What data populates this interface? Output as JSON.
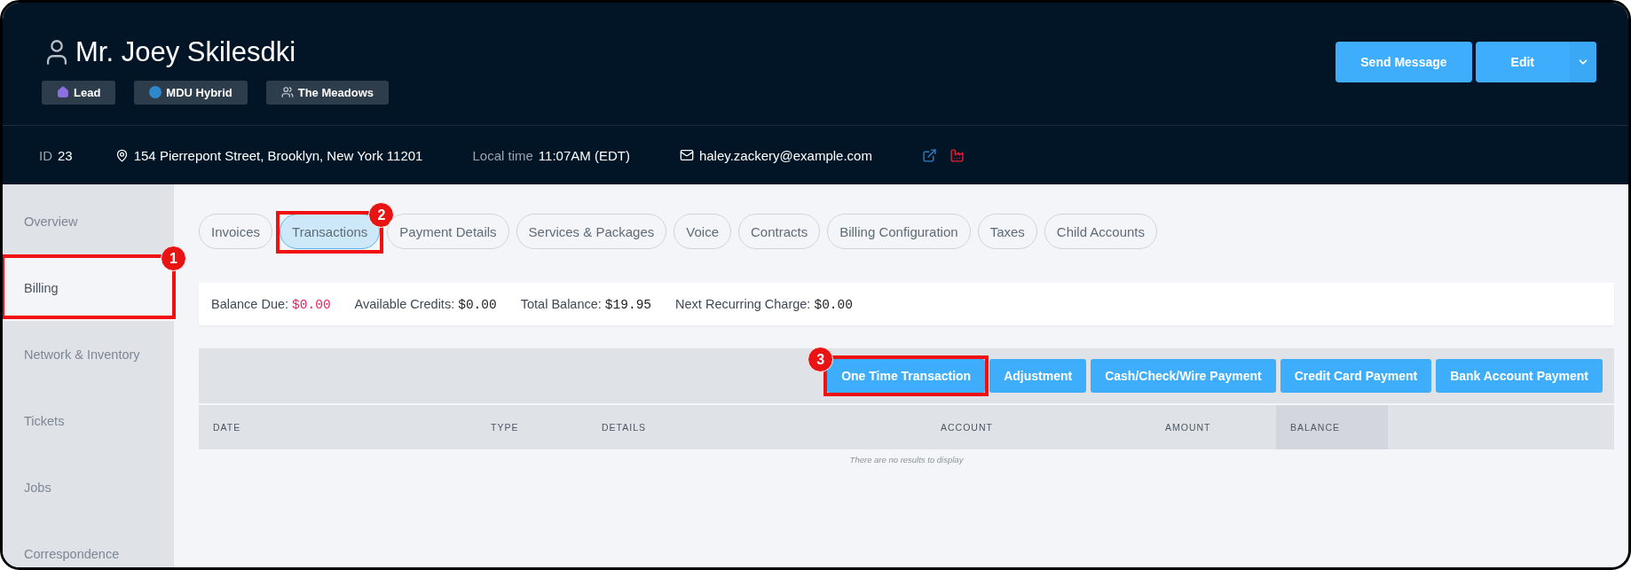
{
  "customer": {
    "name": "Mr. Joey Skilesdki",
    "tags": [
      {
        "kind": "house",
        "label": "Lead"
      },
      {
        "kind": "dot",
        "label": "MDU Hybrid"
      },
      {
        "kind": "users",
        "label": "The Meadows"
      }
    ]
  },
  "header_actions": {
    "primary": "Send Message",
    "split": "Edit"
  },
  "info_bar": {
    "id_label": "ID",
    "id_value": "23",
    "address": "154 Pierrepont Street, Brooklyn, New York 11201",
    "time_label": "Local time",
    "time_value": "11:07AM (EDT)",
    "email": "haley.zackery@example.com"
  },
  "sidebar": {
    "items": [
      {
        "label": "Overview",
        "selected": false
      },
      {
        "label": "Billing",
        "selected": true,
        "callout": {
          "number": "1",
          "badge_left": false
        }
      },
      {
        "label": "Network & Inventory",
        "selected": false
      },
      {
        "label": "Tickets",
        "selected": false
      },
      {
        "label": "Jobs",
        "selected": false
      },
      {
        "label": "Correspondence",
        "selected": false
      }
    ]
  },
  "tabs": [
    {
      "label": "Invoices",
      "selected": false
    },
    {
      "label": "Transactions",
      "selected": true,
      "callout": {
        "number": "2",
        "badge_left": false
      }
    },
    {
      "label": "Payment Details",
      "selected": false
    },
    {
      "label": "Services & Packages",
      "selected": false
    },
    {
      "label": "Voice",
      "selected": false
    },
    {
      "label": "Contracts",
      "selected": false
    },
    {
      "label": "Billing Configuration",
      "selected": false
    },
    {
      "label": "Taxes",
      "selected": false
    },
    {
      "label": "Child Accounts",
      "selected": false
    }
  ],
  "balances": [
    {
      "label": "Balance Due:",
      "value": "$0.00",
      "alert": true
    },
    {
      "label": "Available Credits:",
      "value": "$0.00",
      "alert": false
    },
    {
      "label": "Total Balance:",
      "value": "$19.95",
      "alert": false
    },
    {
      "label": "Next Recurring Charge:",
      "value": "$0.00",
      "alert": false
    }
  ],
  "actions": [
    {
      "label": "One Time Transaction",
      "callout": {
        "number": "3",
        "badge_left": true
      }
    },
    {
      "label": "Adjustment"
    },
    {
      "label": "Cash/Check/Wire Payment"
    },
    {
      "label": "Credit Card Payment"
    },
    {
      "label": "Bank Account Payment"
    }
  ],
  "table": {
    "columns": [
      {
        "label": "DATE",
        "sorted": false
      },
      {
        "label": "TYPE",
        "sorted": false
      },
      {
        "label": "DETAILS",
        "sorted": false
      },
      {
        "label": "ACCOUNT",
        "sorted": false
      },
      {
        "label": "AMOUNT",
        "sorted": false
      },
      {
        "label": "BALANCE",
        "sorted": true
      }
    ],
    "empty_message": "There are no results to display"
  }
}
